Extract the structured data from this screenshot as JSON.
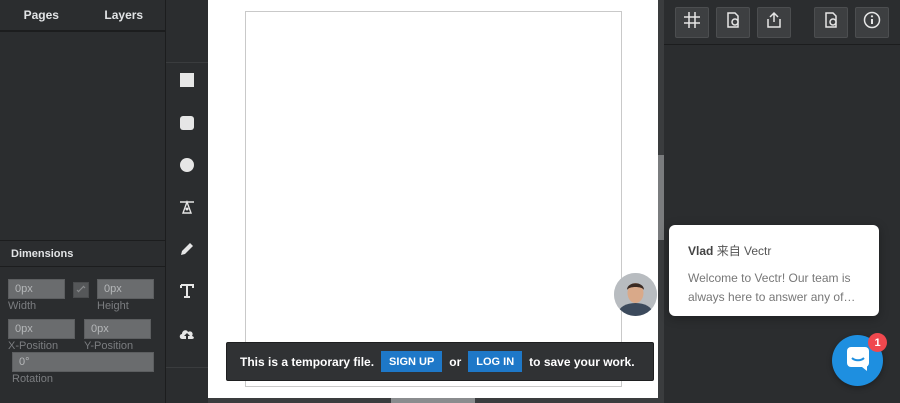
{
  "left_panel": {
    "tabs": [
      "Pages",
      "Layers"
    ],
    "dimensions_title": "Dimensions",
    "fields": {
      "width": {
        "value": "0px",
        "label": "Width"
      },
      "height": {
        "value": "0px",
        "label": "Height"
      },
      "x_position": {
        "value": "0px",
        "label": "X-Position"
      },
      "y_position": {
        "value": "0px",
        "label": "Y-Position"
      },
      "rotation": {
        "value": "0°",
        "label": "Rotation"
      }
    }
  },
  "tools": [
    "rectangle-icon",
    "rounded-rectangle-icon",
    "circle-icon",
    "pen-tool-icon",
    "pencil-icon",
    "text-icon",
    "upload-cloud-icon"
  ],
  "banner": {
    "text_before": "This is a temporary file.",
    "signup_label": "SIGN UP",
    "or_text": "or",
    "login_label": "LOG IN",
    "text_after": "to save your work."
  },
  "right_toolbar": [
    "grid-icon",
    "import-file-icon",
    "share-icon",
    "export-file-icon",
    "info-icon"
  ],
  "chat": {
    "sender": "Vlad",
    "from_text": "来自 Vectr",
    "message": "Welcome to Vectr!  Our team is always here to answer any of…",
    "badge_count": "1"
  },
  "colors": {
    "panel_bg": "#2b2d2f",
    "accent_blue": "#1e78c8",
    "chat_blue": "#1e8fe0",
    "badge_red": "#f0484e"
  }
}
